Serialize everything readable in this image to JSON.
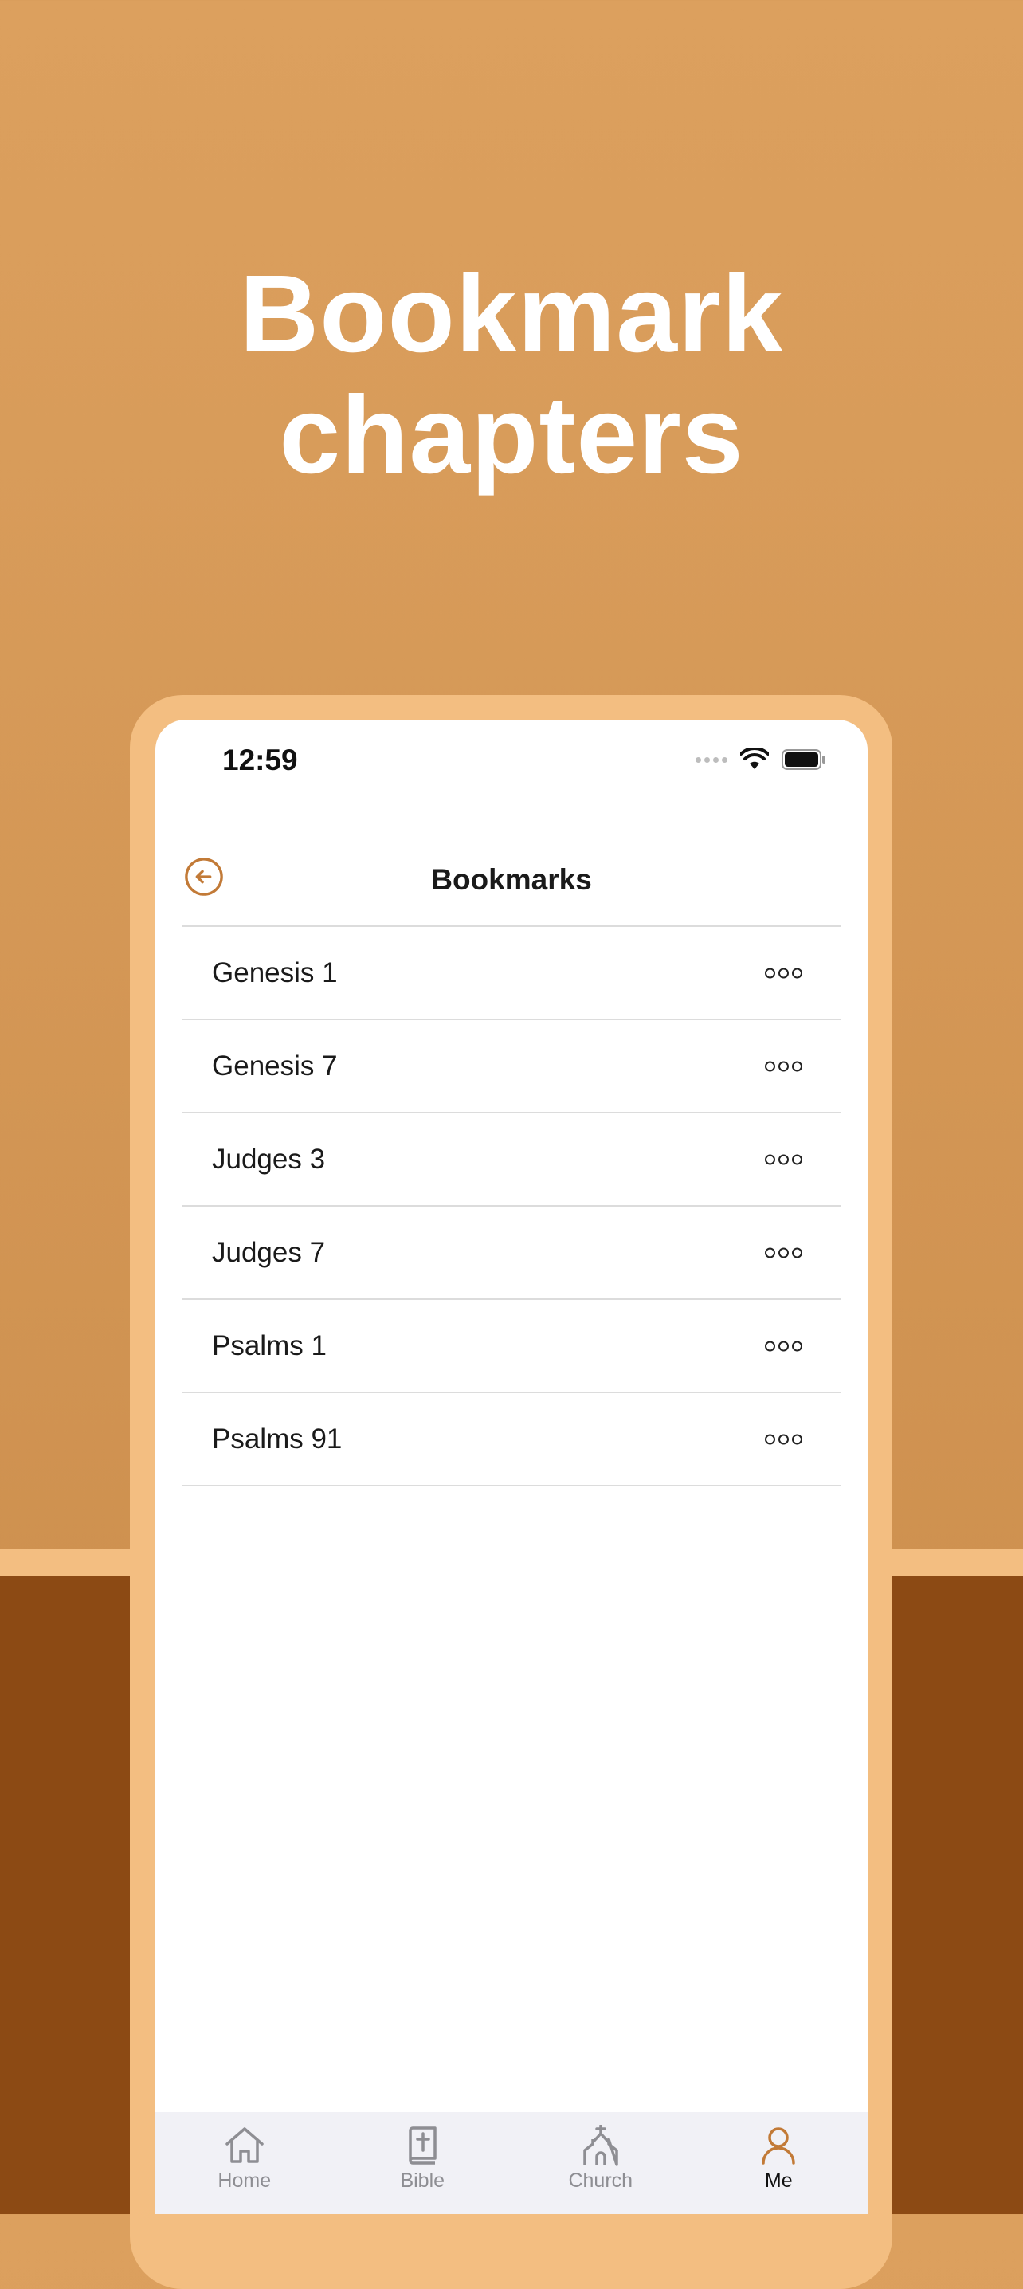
{
  "hero": {
    "line1": "Bookmark",
    "line2": "chapters"
  },
  "colors": {
    "background_top": "#dca05e",
    "background_bottom": "#c98b4a",
    "frame": "#f3be81",
    "floor": "#8c4a14",
    "accent": "#c27a37"
  },
  "status_bar": {
    "time": "12:59"
  },
  "nav": {
    "back_icon": "arrow-left-circle-icon",
    "title": "Bookmarks"
  },
  "bookmarks": [
    {
      "label": "Genesis 1"
    },
    {
      "label": "Genesis 7"
    },
    {
      "label": "Judges 3"
    },
    {
      "label": "Judges 7"
    },
    {
      "label": "Psalms 1"
    },
    {
      "label": "Psalms 91"
    }
  ],
  "tab_bar": {
    "tabs": [
      {
        "label": "Home",
        "icon": "home-icon",
        "active": false
      },
      {
        "label": "Bible",
        "icon": "bible-icon",
        "active": false
      },
      {
        "label": "Church",
        "icon": "church-icon",
        "active": false
      },
      {
        "label": "Me",
        "icon": "person-icon",
        "active": true
      }
    ]
  }
}
